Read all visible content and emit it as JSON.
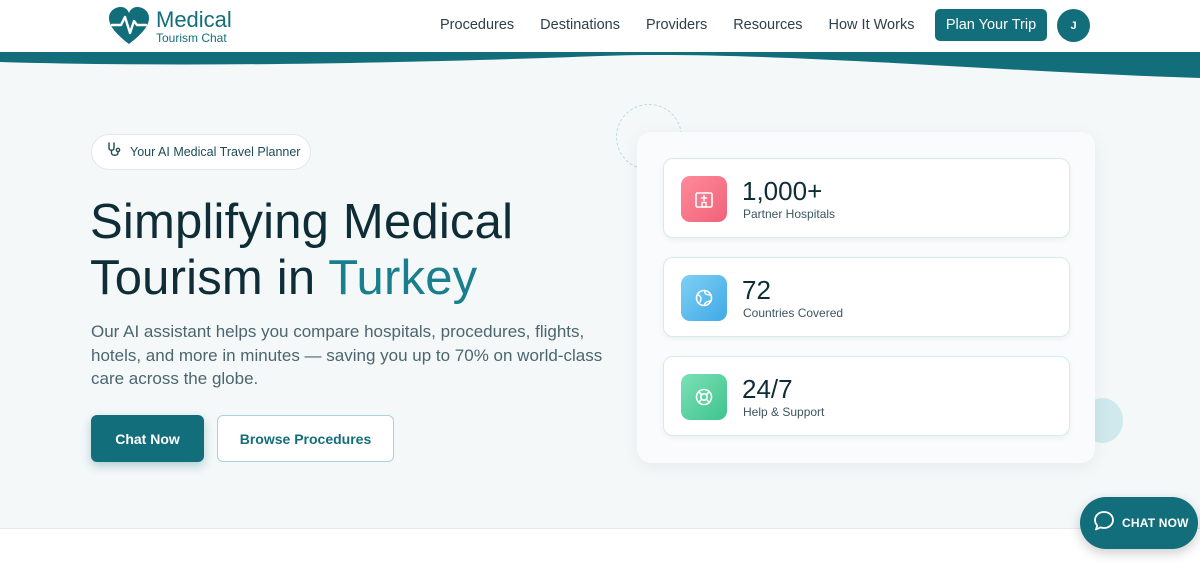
{
  "brand": {
    "title": "Medical",
    "subtitle": "Tourism Chat",
    "logo_icon": "heart-pulse-icon"
  },
  "nav": {
    "items": [
      {
        "label": "Procedures"
      },
      {
        "label": "Destinations"
      },
      {
        "label": "Providers"
      },
      {
        "label": "Resources"
      },
      {
        "label": "How It Works"
      }
    ],
    "cta_label": "Plan Your Trip",
    "avatar_initial": "J"
  },
  "hero": {
    "badge": {
      "icon": "stethoscope-icon",
      "label": "Your AI Medical Travel Planner"
    },
    "headline_line1": "Simplifying Medical",
    "headline_line2_prefix": "Tourism in ",
    "headline_accent": "Turkey",
    "description": "Our AI assistant helps you compare hospitals, procedures, flights, hotels, and more in minutes — saving you up to 70% on world-class care across the globe.",
    "primary_button": "Chat Now",
    "secondary_button": "Browse Procedures"
  },
  "stats": [
    {
      "value": "1,000+",
      "label": "Partner Hospitals",
      "icon": "hospital-icon",
      "color_from": "#ff8a9a",
      "color_to": "#f0627a"
    },
    {
      "value": "72",
      "label": "Countries Covered",
      "icon": "globe-icon",
      "color_from": "#7fd0f5",
      "color_to": "#3fa9e6"
    },
    {
      "value": "24/7",
      "label": "Help & Support",
      "icon": "lifebuoy-icon",
      "color_from": "#7de0b6",
      "color_to": "#3ec48d"
    }
  ],
  "chat_widget": {
    "label": "CHAT NOW",
    "icon": "chat-bubble-icon"
  },
  "colors": {
    "brand": "#136e7b",
    "accent": "#1a7f8c",
    "hero_bg": "#f4f8f9"
  }
}
